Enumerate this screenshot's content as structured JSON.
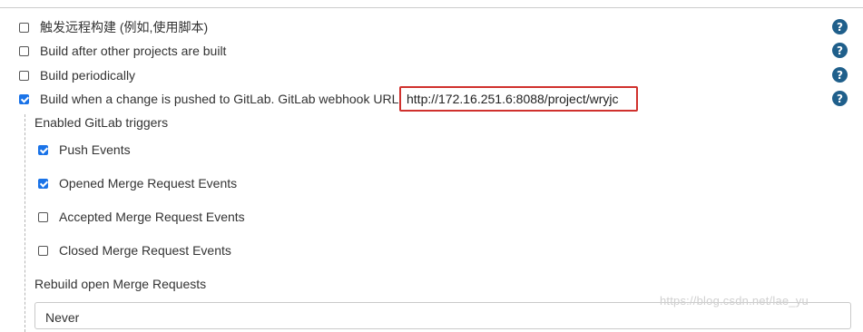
{
  "triggers": [
    {
      "label": "触发远程构建 (例如,使用脚本)",
      "checked": false
    },
    {
      "label": "Build after other projects are built",
      "checked": false
    },
    {
      "label": "Build periodically",
      "checked": false
    },
    {
      "label": "Build when a change is pushed to GitLab. GitLab webhook URL",
      "checked": true
    }
  ],
  "webhook_url": "http://172.16.251.6:8088/project/wryjc",
  "help_icon": "?",
  "gitlab": {
    "enabled_triggers_title": "Enabled GitLab triggers",
    "events": [
      {
        "label": "Push Events",
        "checked": true
      },
      {
        "label": "Opened Merge Request Events",
        "checked": true
      },
      {
        "label": "Accepted Merge Request Events",
        "checked": false
      },
      {
        "label": "Closed Merge Request Events",
        "checked": false
      }
    ],
    "rebuild_title": "Rebuild open Merge Requests",
    "rebuild_value": "Never"
  },
  "watermark": "https://blog.csdn.net/lae_yu",
  "colors": {
    "checkbox_checked": "#1a73e8",
    "help_icon": "#1f5f8b",
    "highlight_border": "#d0312d"
  }
}
